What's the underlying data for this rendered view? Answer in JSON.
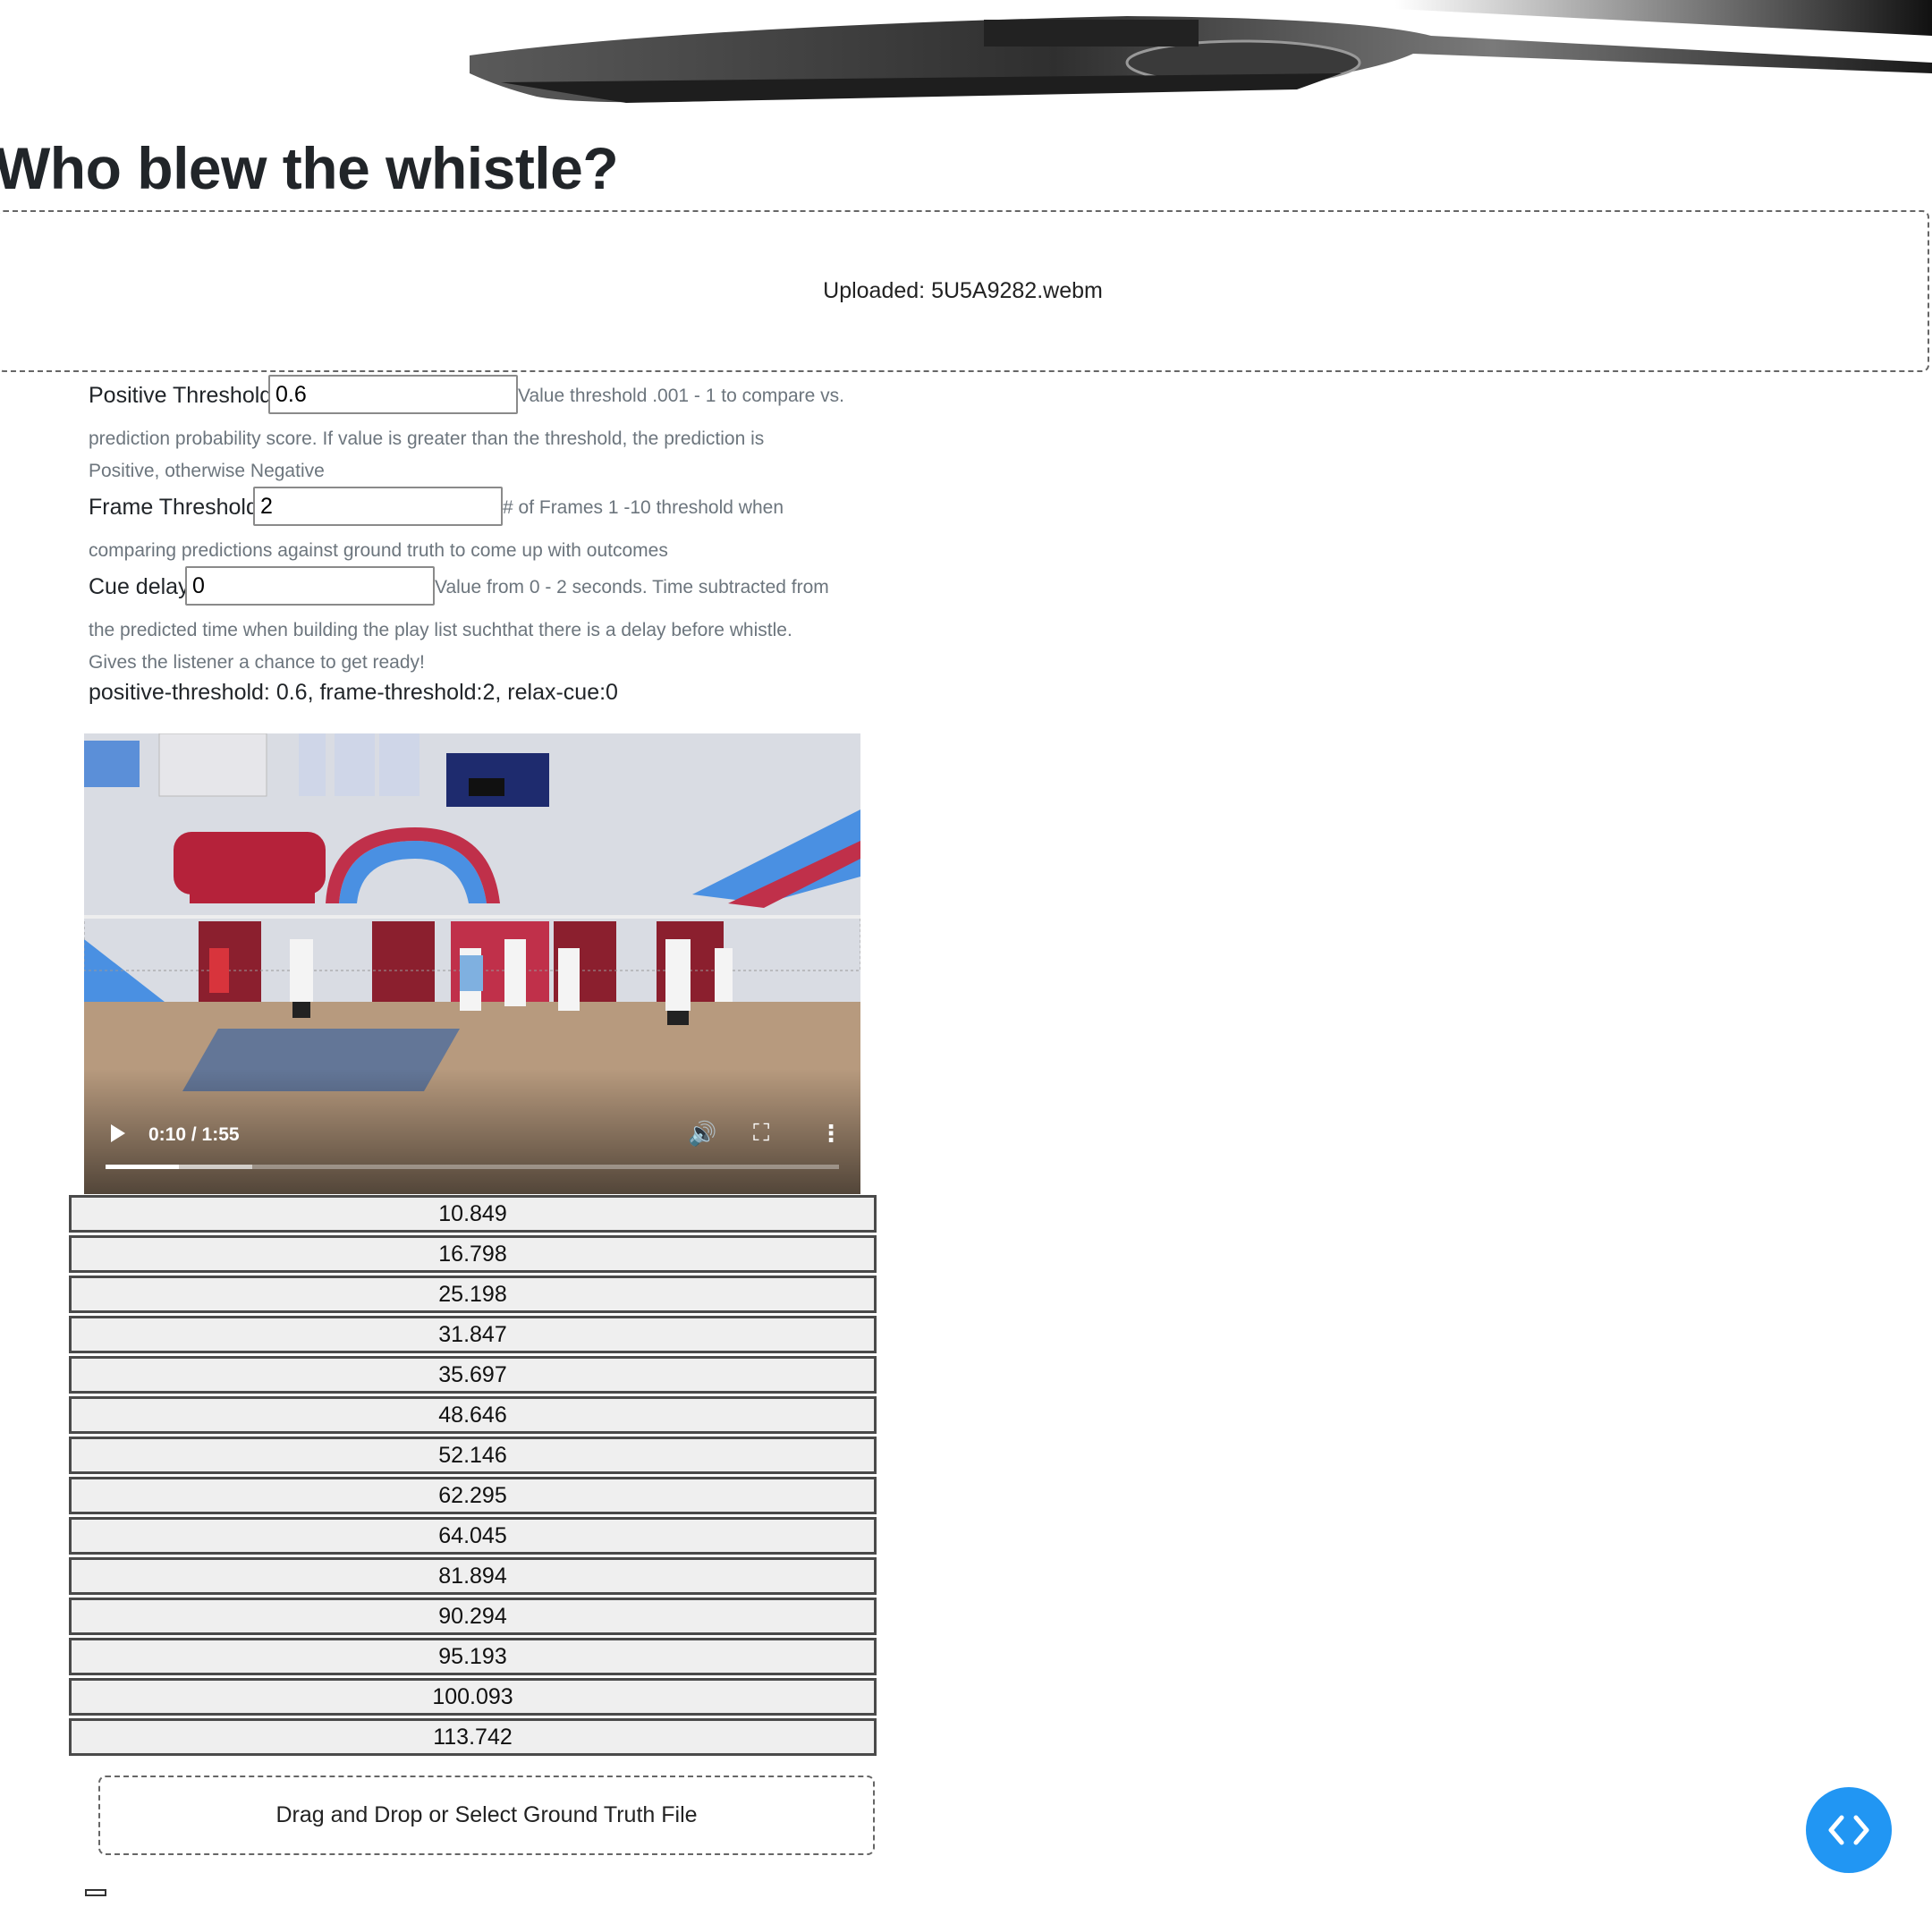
{
  "page": {
    "title": "Who blew the whistle?"
  },
  "upload": {
    "status": "Uploaded: 5U5A9282.webm"
  },
  "fields": {
    "positive_threshold": {
      "label": "Positive Threshold",
      "value": "0.6",
      "help_line1": "Value threshold .001 - 1 to compare vs.",
      "help_line2": "prediction probability score. If value is greater than the threshold, the prediction is",
      "help_line3": "Positive, otherwise Negative"
    },
    "frame_threshold": {
      "label": "Frame Threshold",
      "value": "2",
      "help_line1": "# of Frames 1 -10 threshold when",
      "help_line2": "comparing predictions against ground truth to come up with outcomes"
    },
    "cue_delay": {
      "label": "Cue delay",
      "value": "0",
      "help_line1": "Value from 0 - 2 seconds. Time subtracted from",
      "help_line2": "the predicted time when building the play list suchthat there is a delay before whistle.",
      "help_line3": "Gives the listener a chance to get ready!"
    }
  },
  "summary": "positive-threshold: 0.6, frame-threshold:2, relax-cue:0",
  "video": {
    "time": "0:10 / 1:55",
    "played_fraction": 0.1,
    "buffered_fraction": 0.2
  },
  "predicted_times": [
    "10.849",
    "16.798",
    "25.198",
    "31.847",
    "35.697",
    "48.646",
    "52.146",
    "62.295",
    "64.045",
    "81.894",
    "90.294",
    "95.193",
    "100.093",
    "113.742"
  ],
  "ground_truth": {
    "label": "Drag and Drop or Select Ground Truth File"
  },
  "colors": {
    "fab": "#2196f3",
    "help_text": "#6c757d"
  }
}
